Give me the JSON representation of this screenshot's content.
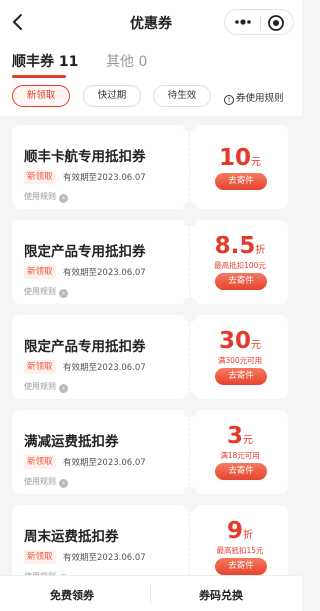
{
  "header": {
    "title": "优惠券"
  },
  "tabs": [
    {
      "label": "顺丰券 11"
    },
    {
      "label": "其他 0"
    }
  ],
  "filters": [
    {
      "label": "新领取"
    },
    {
      "label": "快过期"
    },
    {
      "label": "待生效"
    }
  ],
  "rules_link": {
    "icon": "!",
    "label": "券使用规则"
  },
  "coupons": [
    {
      "name": "顺丰卡航专用抵扣券",
      "badge": "新领取",
      "validity": "有效期至2023.06.07",
      "rule": "使用规则",
      "amount": "10",
      "unit": "元",
      "condition": "",
      "action": "去寄件"
    },
    {
      "name": "限定产品专用抵扣券",
      "badge": "新领取",
      "validity": "有效期至2023.06.07",
      "rule": "使用规则",
      "amount": "8.5",
      "unit": "折",
      "condition": "最高抵扣100元",
      "action": "去寄件"
    },
    {
      "name": "限定产品专用抵扣券",
      "badge": "新领取",
      "validity": "有效期至2023.06.07",
      "rule": "使用规则",
      "amount": "30",
      "unit": "元",
      "condition": "满300元可用",
      "action": "去寄件"
    },
    {
      "name": "满减运费抵扣券",
      "badge": "新领取",
      "validity": "有效期至2023.06.07",
      "rule": "使用规则",
      "amount": "3",
      "unit": "元",
      "condition": "满18元可用",
      "action": "去寄件"
    },
    {
      "name": "周末运费抵扣券",
      "badge": "新领取",
      "validity": "有效期至2023.06.07",
      "rule": "使用规则",
      "amount": "9",
      "unit": "折",
      "condition": "最高抵扣15元",
      "action": "去寄件"
    }
  ],
  "bottom": {
    "free_label": "免费领券",
    "redeem_label": "券码兑换"
  },
  "colors": {
    "accent": "#e53a2a",
    "background": "#f5f5f5"
  }
}
